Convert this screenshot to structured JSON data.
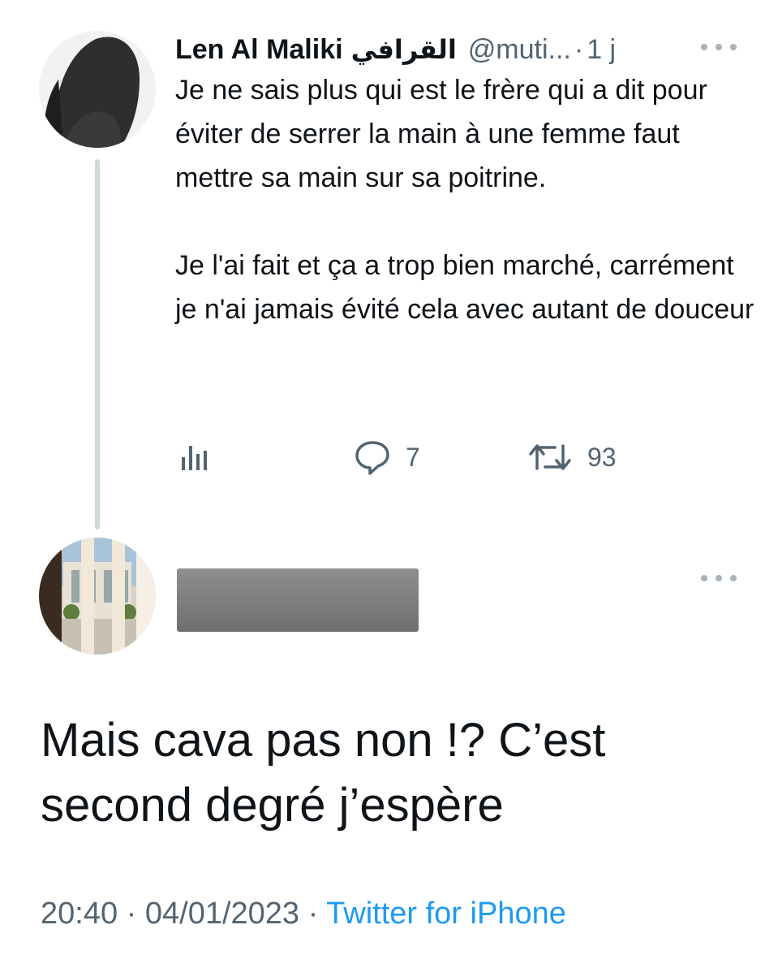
{
  "parent_tweet": {
    "author_name": "Len Al Maliki",
    "author_name_arabic": "القرافي",
    "handle": "@muti...",
    "time_ago": "1 j",
    "paragraphs": [
      "Je ne sais plus qui est le frère qui a dit pour éviter de serrer la main à une femme faut mettre sa main sur sa poitrine.",
      "Je l'ai fait et ça a trop bien marché, carrément je n'ai jamais évité cela avec autant de douceur"
    ],
    "actions": {
      "views_icon": "analytics-icon",
      "replies_icon": "reply-icon",
      "replies_count": "7",
      "retweets_icon": "retweet-icon",
      "retweets_count": "93"
    }
  },
  "reply_tweet": {
    "author_redacted": true,
    "text": "Mais cava pas non !? C’est second degré j’espère",
    "time": "20:40",
    "date": "04/01/2023",
    "client": "Twitter for iPhone"
  },
  "colors": {
    "text_primary": "#0f1419",
    "text_secondary": "#536471",
    "link_blue": "#1d9bf0",
    "thread_line": "#cfd9de"
  }
}
